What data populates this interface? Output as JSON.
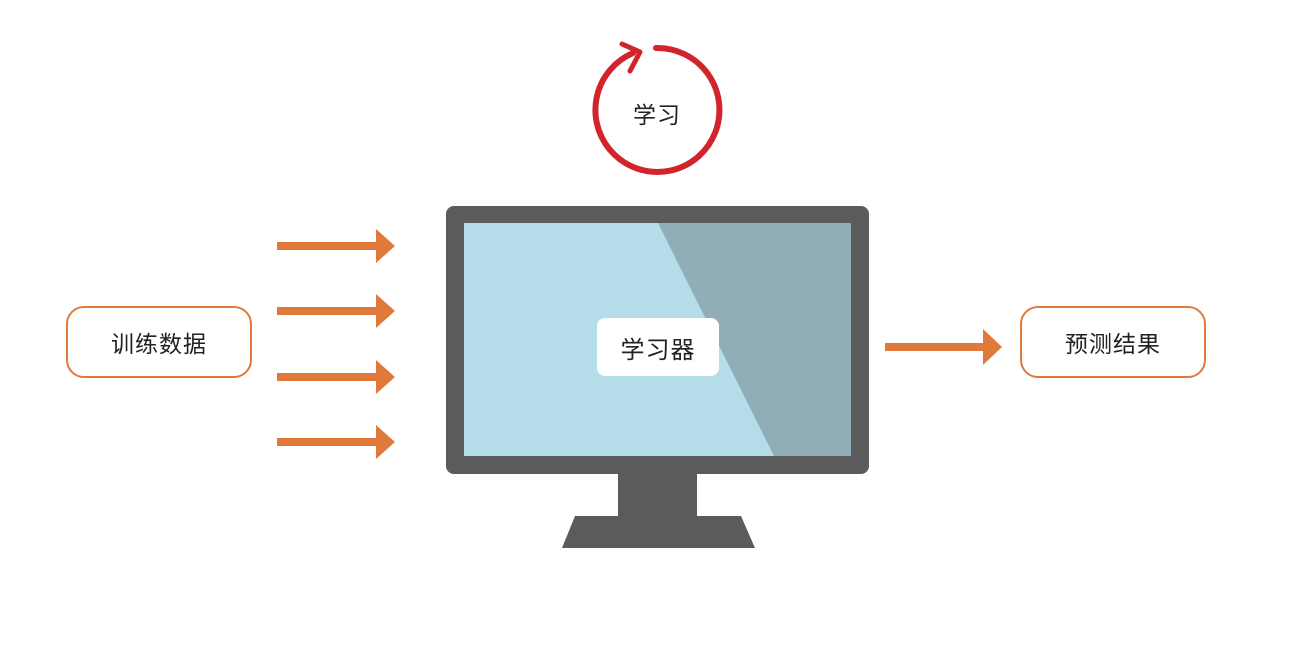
{
  "diagram": {
    "cycle_label": "学习",
    "input_label": "训练数据",
    "learner_label": "学习器",
    "output_label": "预测结果"
  },
  "colors": {
    "arrow": "#e07a3a",
    "box_border": "#e07a3a",
    "cycle": "#d1242c",
    "monitor_frame": "#5b5b5b",
    "screen_light": "#b5dde9",
    "screen_shade": "#91adb8"
  },
  "icons": {
    "cycle": "circular-arrow-icon",
    "learner": "monitor-icon",
    "flow": "right-arrow-icon"
  }
}
